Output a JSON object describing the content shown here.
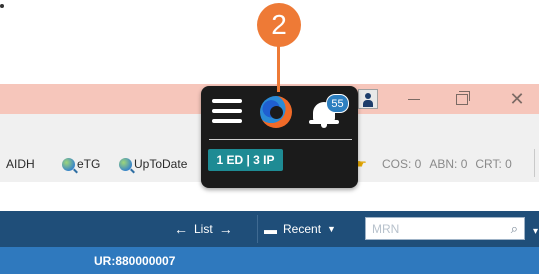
{
  "callout": {
    "number": "2"
  },
  "popover": {
    "notification_count": "55",
    "census_label": "1 ED | 3 IP"
  },
  "toolbar": {
    "links": [
      "AIDH",
      "eTG",
      "UpToDate"
    ],
    "status": {
      "cos": "COS: 0",
      "abn": "ABN: 0",
      "crt": "CRT: 0"
    }
  },
  "nav": {
    "list_label": "List",
    "recent_label": "Recent",
    "mrn_placeholder": "MRN"
  },
  "patient": {
    "ur": "UR:880000007"
  },
  "colors": {
    "title_bar": "#f6c6bb",
    "nav_bar": "#1f4e79",
    "patient_bar": "#2f79be",
    "callout": "#ee7a36",
    "census_pill": "#1e8b94",
    "badge": "#2d7fc0"
  }
}
